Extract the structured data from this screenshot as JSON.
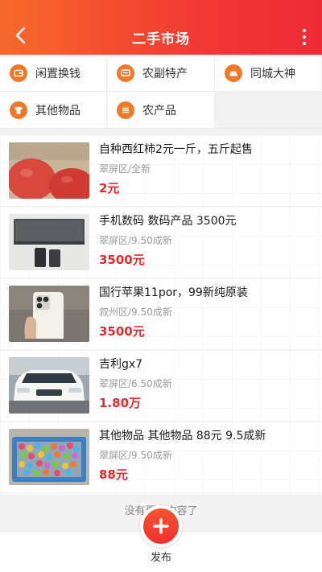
{
  "header": {
    "title": "二手市场",
    "back_icon": "chevron-left-icon",
    "more_icon": "more-vertical-icon"
  },
  "categories": [
    {
      "label": "闲置换钱",
      "icon": "wallet-icon"
    },
    {
      "label": "农副特产",
      "icon": "tv-box-icon"
    },
    {
      "label": "同城大神",
      "icon": "car-icon"
    },
    {
      "label": "其他物品",
      "icon": "shirt-icon"
    },
    {
      "label": "农产品",
      "icon": "menu-lines-icon"
    }
  ],
  "colors": {
    "header_start": "#f7692a",
    "header_end": "#ee2a36",
    "icon_orange": "#f0782a",
    "price_red": "#e8272b"
  },
  "items": [
    {
      "title": "自种西红柿2元一斤，五斤起售",
      "location": "翠屏区/全新",
      "price": "2元",
      "image": "tomatoes"
    },
    {
      "title": "手机数码 数码产品 3500元",
      "location": "翠屏区/9.50成新",
      "price": "3500元",
      "image": "laptop"
    },
    {
      "title": "国行苹果11por，99新纯原装",
      "location": "叙州区/9.50成新",
      "price": "3500元",
      "image": "iphone"
    },
    {
      "title": "吉利gx7",
      "location": "翠屏区/6.50成新",
      "price": "1.80万",
      "image": "white-car"
    },
    {
      "title": "其他物品 其他物品 88元 9.5成新",
      "location": "翠屏区/9.50成新",
      "price": "88元",
      "image": "ball-pit"
    }
  ],
  "footer": {
    "no_more_text": "没有更多内容了",
    "publish_label": "发布",
    "publish_icon": "plus-icon"
  }
}
